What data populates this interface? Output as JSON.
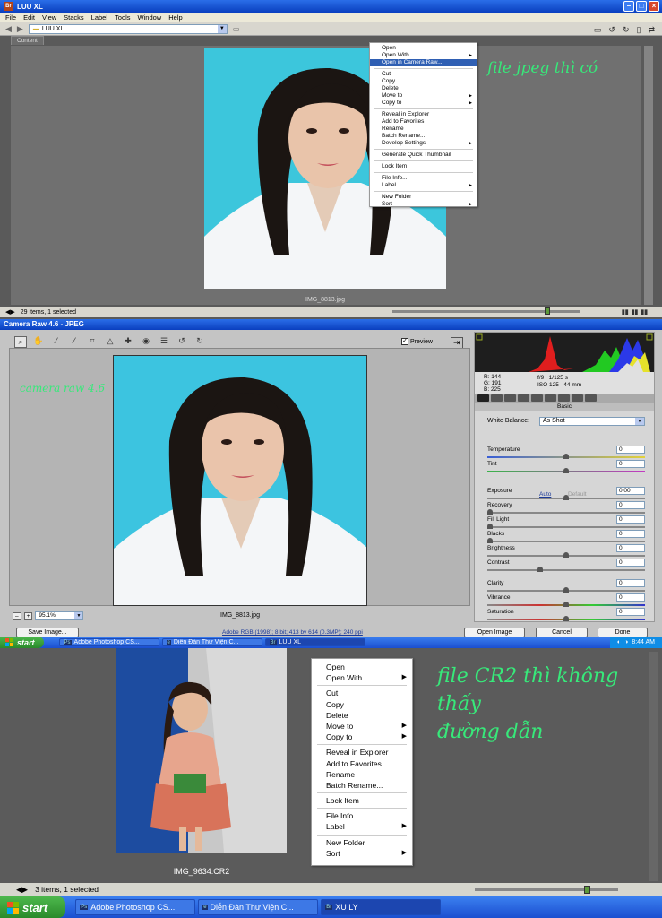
{
  "colors": {
    "xp_blue": "#0a3fbf",
    "photo_bg": "#3cc6dc",
    "note_green": "#37e97a",
    "bridge_gray": "#5a5a5a"
  },
  "bridge1": {
    "app_badge": "Br",
    "title": "LUU XL",
    "menu": [
      "File",
      "Edit",
      "View",
      "Stacks",
      "Label",
      "Tools",
      "Window",
      "Help"
    ],
    "path": "LUU XL",
    "tab": "Content",
    "filename": "IMG_8813.jpg",
    "status": "29 items, 1 selected",
    "note": "file jpeg thì có",
    "context_menu": [
      {
        "label": "Open"
      },
      {
        "label": "Open With",
        "sub": true
      },
      {
        "label": "Open in Camera Raw...",
        "selected": true
      },
      {
        "sep": true
      },
      {
        "label": "Cut"
      },
      {
        "label": "Copy"
      },
      {
        "label": "Delete"
      },
      {
        "label": "Move to",
        "sub": true
      },
      {
        "label": "Copy to",
        "sub": true
      },
      {
        "sep": true
      },
      {
        "label": "Reveal in Explorer"
      },
      {
        "label": "Add to Favorites"
      },
      {
        "label": "Rename"
      },
      {
        "label": "Batch Rename..."
      },
      {
        "label": "Develop Settings",
        "sub": true
      },
      {
        "sep": true
      },
      {
        "label": "Generate Quick Thumbnail"
      },
      {
        "sep": true
      },
      {
        "label": "Lock Item"
      },
      {
        "sep": true
      },
      {
        "label": "File Info..."
      },
      {
        "label": "Label",
        "sub": true
      },
      {
        "sep": true
      },
      {
        "label": "New Folder"
      },
      {
        "label": "Sort",
        "sub": true
      }
    ]
  },
  "camera_raw": {
    "title": "Camera Raw 4.6  -  JPEG",
    "preview_label": "Preview",
    "note": "camera raw 4.6",
    "zoom": "95.1%",
    "filename": "IMG_8813.jpg",
    "rgb": {
      "r": "R:  144",
      "g": "G:  191",
      "b": "B:  225"
    },
    "exif": {
      "aperture": "f/9",
      "shutter": "1/125 s",
      "iso": "ISO 125",
      "focal": "44 mm"
    },
    "panel_title": "Basic",
    "white_balance_label": "White Balance:",
    "white_balance_value": "As Shot",
    "auto": "Auto",
    "default": "Default",
    "controls": [
      {
        "label": "Temperature",
        "value": "0",
        "pos": 0.5
      },
      {
        "label": "Tint",
        "value": "0",
        "pos": 0.5
      },
      {
        "label": "Exposure",
        "value": "0.00",
        "pos": 0.5
      },
      {
        "label": "Recovery",
        "value": "0",
        "pos": 0.0
      },
      {
        "label": "Fill Light",
        "value": "0",
        "pos": 0.0
      },
      {
        "label": "Blacks",
        "value": "0",
        "pos": 0.0
      },
      {
        "label": "Brightness",
        "value": "0",
        "pos": 0.5
      },
      {
        "label": "Contrast",
        "value": "0",
        "pos": 0.33
      },
      {
        "label": "Clarity",
        "value": "0",
        "pos": 0.5
      },
      {
        "label": "Vibrance",
        "value": "0",
        "pos": 0.5
      },
      {
        "label": "Saturation",
        "value": "0",
        "pos": 0.5
      }
    ],
    "save_button": "Save Image...",
    "workflow": "Adobe RGB (1998); 8 bit; 413 by 614 (0.3MP); 240 ppi",
    "open_button": "Open Image",
    "cancel_button": "Cancel",
    "done_button": "Done"
  },
  "taskbar1": {
    "start": "start",
    "tasks": [
      {
        "icon": "Ps",
        "label": "Adobe Photoshop CS..."
      },
      {
        "icon": "e",
        "label": "Diễn Đàn Thư Viện C..."
      },
      {
        "icon": "Br",
        "label": "LUU XL",
        "active": true
      }
    ],
    "clock": "8:44 AM"
  },
  "bridge2": {
    "filename": "IMG_9634.CR2",
    "dots": ". . . . .",
    "status": "3 items, 1 selected",
    "note_line1": "file CR2 thì không thấy",
    "note_line2": "đường dẫn",
    "context_menu": [
      {
        "label": "Open"
      },
      {
        "label": "Open With",
        "sub": true
      },
      {
        "sep": true
      },
      {
        "label": "Cut"
      },
      {
        "label": "Copy"
      },
      {
        "label": "Delete"
      },
      {
        "label": "Move to",
        "sub": true
      },
      {
        "label": "Copy to",
        "sub": true
      },
      {
        "sep": true
      },
      {
        "label": "Reveal in Explorer"
      },
      {
        "label": "Add to Favorites"
      },
      {
        "label": "Rename"
      },
      {
        "label": "Batch Rename..."
      },
      {
        "sep": true
      },
      {
        "label": "Lock Item"
      },
      {
        "sep": true
      },
      {
        "label": "File Info..."
      },
      {
        "label": "Label",
        "sub": true
      },
      {
        "sep": true
      },
      {
        "label": "New Folder"
      },
      {
        "label": "Sort",
        "sub": true
      }
    ]
  },
  "taskbar2": {
    "start": "start",
    "tasks": [
      {
        "icon": "Ps",
        "label": "Adobe Photoshop CS..."
      },
      {
        "icon": "e",
        "label": "Diễn Đàn Thư Viện C..."
      },
      {
        "icon": "Br",
        "label": "XU LY",
        "active": true
      }
    ]
  }
}
